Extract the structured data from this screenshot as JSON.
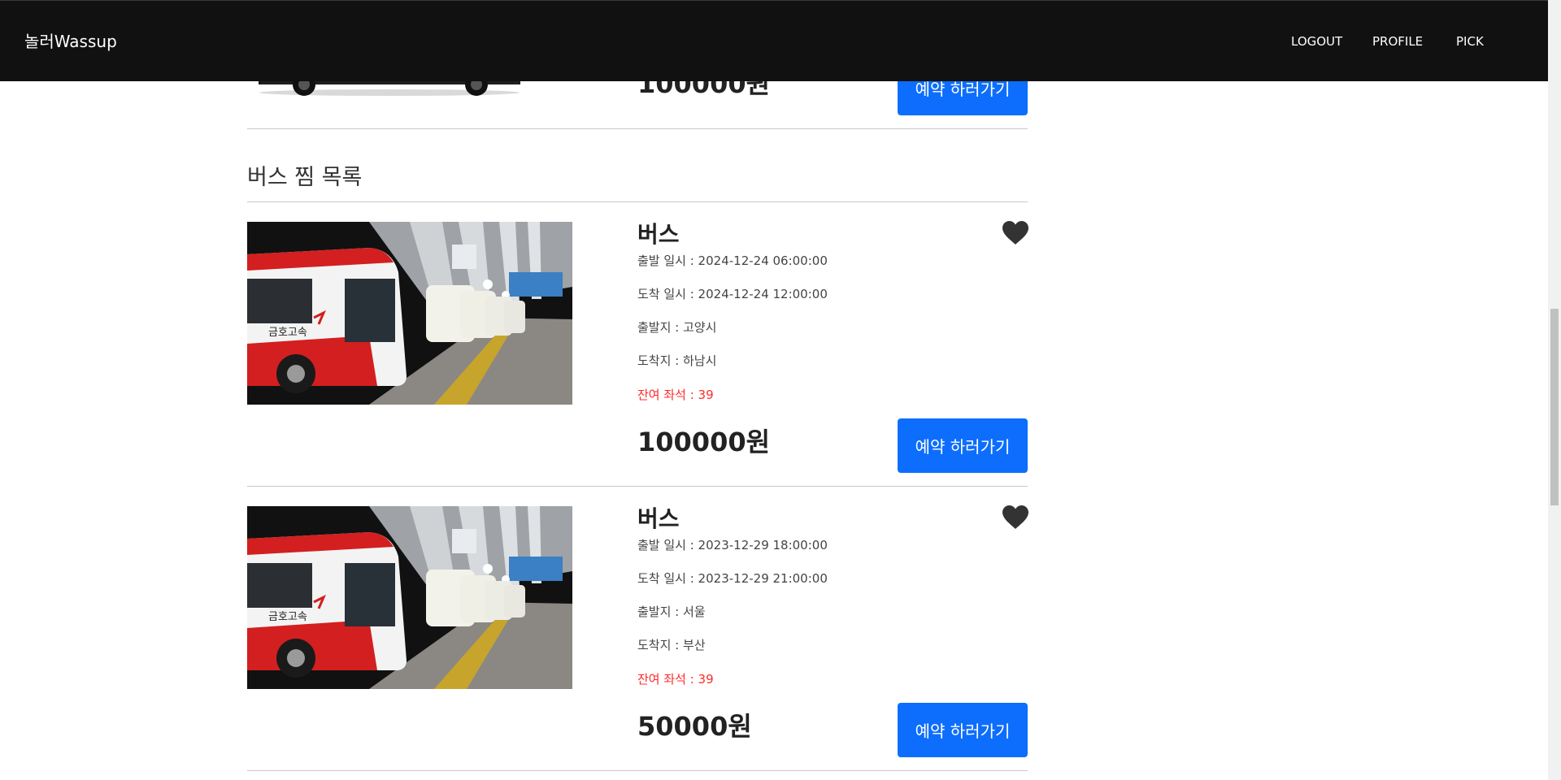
{
  "nav": {
    "brand": "놀러Wassup",
    "links": [
      "LOGOUT",
      "PROFILE",
      "PICK"
    ]
  },
  "previous_card": {
    "price": "100000원",
    "button_label": "예약 하러가기"
  },
  "section": {
    "title": "버스 찜 목록"
  },
  "cards": [
    {
      "title": "버스",
      "departure_time": "출발 일시 : 2024-12-24 06:00:00",
      "arrival_time": "도착 일시 : 2024-12-24 12:00:00",
      "origin": "출발지 : 고양시",
      "destination": "도착지 : 하남시",
      "seats": "잔여 좌석 : 39",
      "price": "100000원",
      "button_label": "예약 하러가기",
      "bus_logo_text": "금호고속"
    },
    {
      "title": "버스",
      "departure_time": "출발 일시 : 2023-12-29 18:00:00",
      "arrival_time": "도착 일시 : 2023-12-29 21:00:00",
      "origin": "출발지 : 서울",
      "destination": "도착지 : 부산",
      "seats": "잔여 좌석 : 39",
      "price": "50000원",
      "button_label": "예약 하러가기",
      "bus_logo_text": "금호고속"
    }
  ],
  "colors": {
    "navbar": "#111111",
    "primary_button": "#0d6efd",
    "seats_text": "#ff2a2a",
    "heart": "#333333"
  },
  "icons": {
    "favorite": "heart-icon"
  }
}
